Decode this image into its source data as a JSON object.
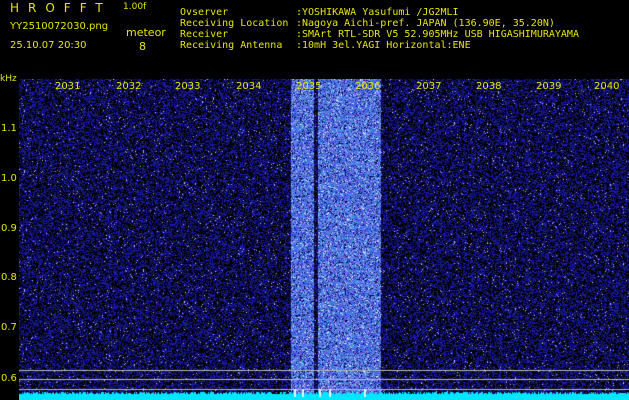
{
  "header": {
    "app_name": "HROFFT",
    "version": "1.00f",
    "filename": "YY2510072030.png",
    "timestamp": "25.10.07 20:30",
    "mode": "meteor",
    "count": "8"
  },
  "info": [
    {
      "label": "Ovserver",
      "value": ":YOSHIKAWA Yasufumi /JG2MLI"
    },
    {
      "label": "Receiving Location",
      "value": ":Nagoya Aichi-pref. JAPAN (136.90E, 35.20N)"
    },
    {
      "label": "Receiver",
      "value": ":SMArt RTL-SDR V5 52.905MHz USB HIGASHIMURAYAMA"
    },
    {
      "label": "Receiving Antenna",
      "value": ":10mH 3el.YAGI Horizontal:ENE"
    }
  ],
  "spectrogram": {
    "y_unit": "kHz",
    "y_ticks": [
      "1.1",
      "1.0",
      "0.9",
      "0.8",
      "0.7",
      "0.6"
    ],
    "x_ticks": [
      "2031",
      "2032",
      "2033",
      "2034",
      "2035",
      "2036",
      "2037",
      "2038",
      "2039",
      "2040"
    ],
    "colors": {
      "background": "#000000",
      "noise": "#1a1aa8",
      "burst": "#5a78ff",
      "baseline": "#00e6ff",
      "text": "#e6e600"
    }
  }
}
